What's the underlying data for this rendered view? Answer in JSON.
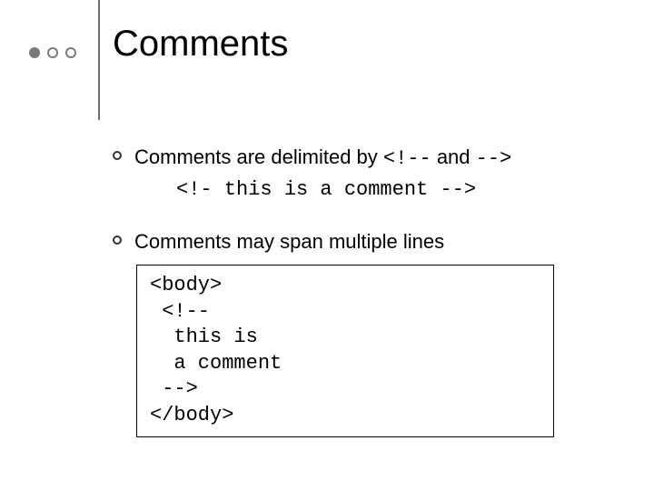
{
  "title": "Comments",
  "bullet1": {
    "text_before": "Comments are delimited by ",
    "open_delim": "<!--",
    "mid": "  and ",
    "close_delim": "-->",
    "example": "<!- this is a comment -->"
  },
  "bullet2": {
    "text": "Comments may span multiple lines",
    "code": "<body>\n <!--\n  this is\n  a comment\n -->\n</body>"
  }
}
